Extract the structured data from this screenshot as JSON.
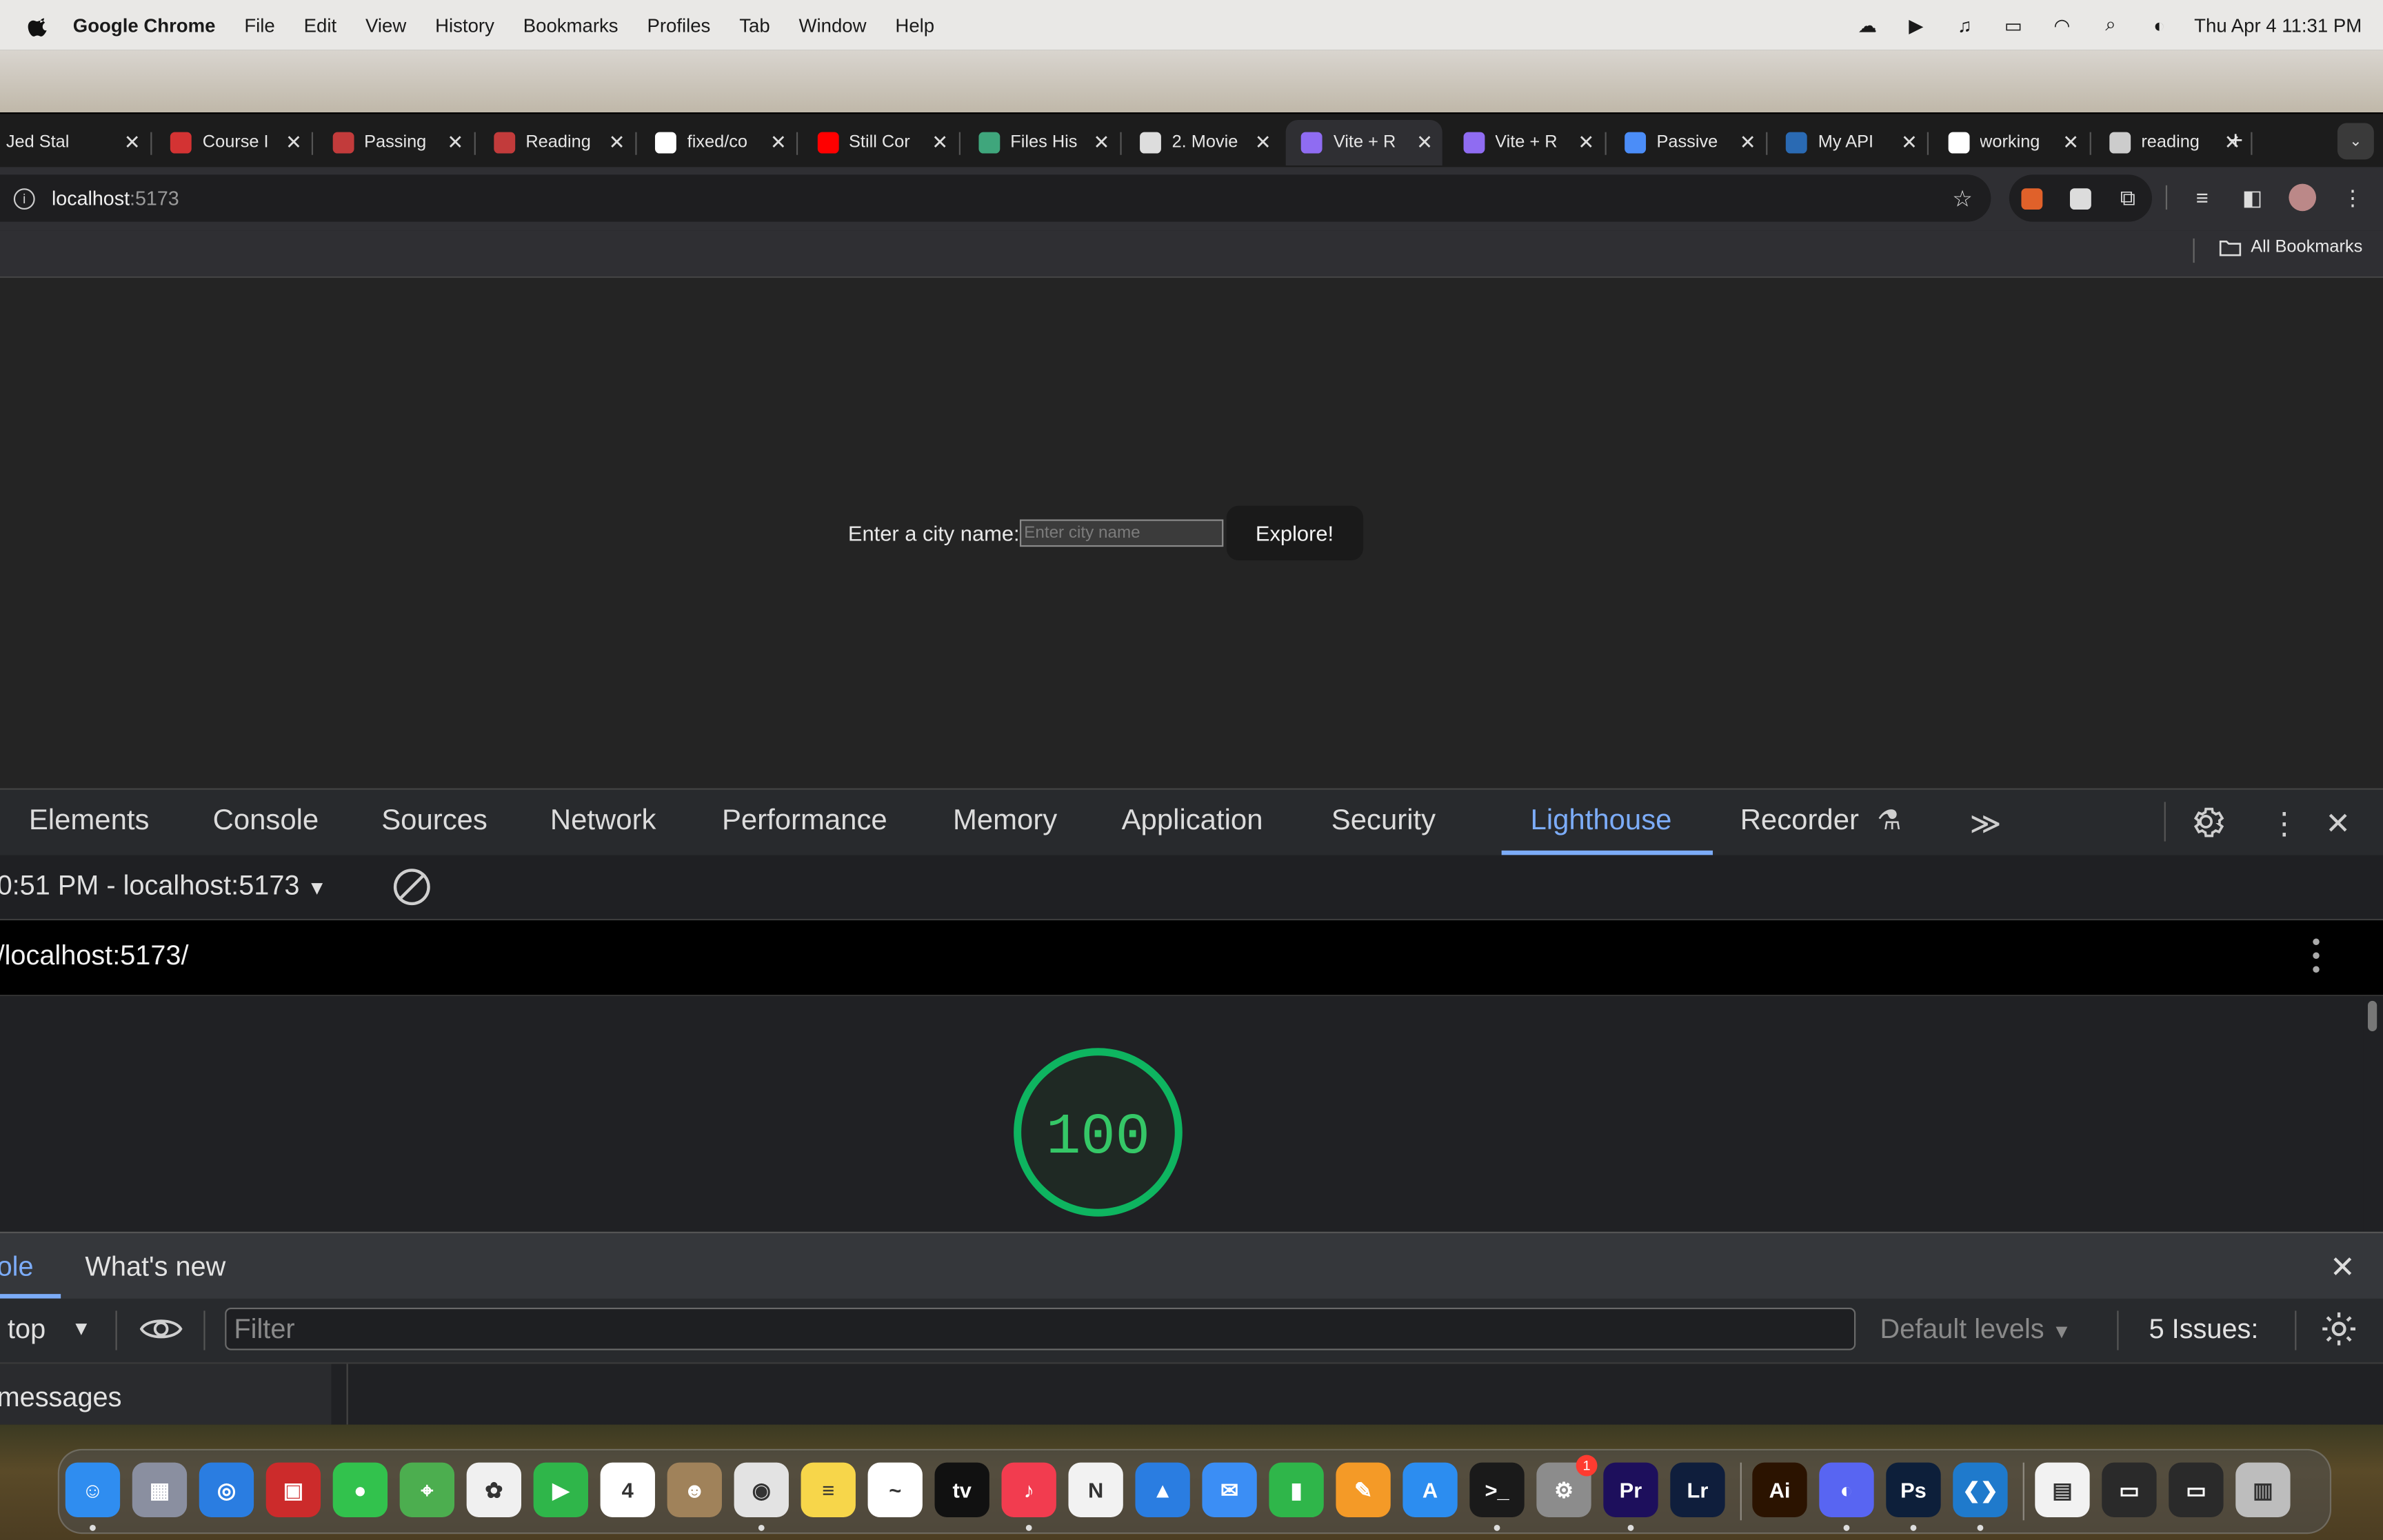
{
  "menubar": {
    "app_name": "Google Chrome",
    "items": [
      "File",
      "Edit",
      "View",
      "History",
      "Bookmarks",
      "Profiles",
      "Tab",
      "Window",
      "Help"
    ],
    "clock": "Thu Apr 4  11:31 PM"
  },
  "tabs": [
    {
      "title": "Jed Stal",
      "favicon": "#555555"
    },
    {
      "title": "Course I",
      "favicon": "#d33333"
    },
    {
      "title": "Passing",
      "favicon": "#c23b3b"
    },
    {
      "title": "Reading",
      "favicon": "#c23b3b"
    },
    {
      "title": "fixed/co",
      "favicon": "#ffffff"
    },
    {
      "title": "Still Cor",
      "favicon": "#ff0000"
    },
    {
      "title": "Files His",
      "favicon": "#3fa67c"
    },
    {
      "title": "2. Movie",
      "favicon": "#dddddd"
    },
    {
      "title": "Vite + R",
      "favicon": "#8f6cf2"
    },
    {
      "title": "Vite + R",
      "favicon": "#8f6cf2"
    },
    {
      "title": "Passive",
      "favicon": "#4b8df8"
    },
    {
      "title": "My API",
      "favicon": "#2a6ab3"
    },
    {
      "title": "working",
      "favicon": "#ffffff"
    },
    {
      "title": "reading",
      "favicon": "#cccccc"
    }
  ],
  "active_tab_index": 8,
  "address": {
    "host": "localhost",
    "port": ":5173"
  },
  "bookmarks": {
    "all_label": "All Bookmarks"
  },
  "page": {
    "label": "Enter a city name:",
    "placeholder": "Enter city name",
    "button": "Explore!"
  },
  "devtools": {
    "tabs": [
      "Elements",
      "Console",
      "Sources",
      "Network",
      "Performance",
      "Memory",
      "Application",
      "Security",
      "Lighthouse",
      "Recorder"
    ],
    "active_tab": "Lighthouse",
    "more_label": "≫",
    "report_selector": "0:51 PM - localhost:5173",
    "report_url": "/localhost:5173/",
    "score": "100",
    "score_value": 100
  },
  "drawer": {
    "tabs": [
      "ole",
      "What's new"
    ],
    "context": "top",
    "filter_placeholder": "Filter",
    "levels": "Default levels",
    "issues": "5 Issues:",
    "sidebar_item": "messages"
  },
  "dock": {
    "apps": [
      {
        "name": "Finder",
        "color": "#2f8df0",
        "glyph": "☺",
        "dot": true
      },
      {
        "name": "Launchpad",
        "color": "#8a8fa0",
        "glyph": "▦",
        "dot": false
      },
      {
        "name": "Safari",
        "color": "#2a7de1",
        "glyph": "◎",
        "dot": false
      },
      {
        "name": "Photo Booth",
        "color": "#cc2b2b",
        "glyph": "▣",
        "dot": false
      },
      {
        "name": "Messages",
        "color": "#32c24d",
        "glyph": "●",
        "dot": false
      },
      {
        "name": "Maps",
        "color": "#4cae4f",
        "glyph": "⌖",
        "dot": false
      },
      {
        "name": "Photos",
        "color": "#f0f0f0",
        "glyph": "✿",
        "dot": false
      },
      {
        "name": "FaceTime",
        "color": "#2fb64a",
        "glyph": "▶",
        "dot": false
      },
      {
        "name": "Calendar",
        "color": "#ffffff",
        "glyph": "4",
        "dot": false
      },
      {
        "name": "Contacts",
        "color": "#a0825a",
        "glyph": "☻",
        "dot": false
      },
      {
        "name": "Chrome",
        "color": "#e3e3e3",
        "glyph": "◉",
        "dot": true
      },
      {
        "name": "Notes",
        "color": "#f7d64a",
        "glyph": "≡",
        "dot": false
      },
      {
        "name": "Freeform",
        "color": "#ffffff",
        "glyph": "~",
        "dot": false
      },
      {
        "name": "TV",
        "color": "#111111",
        "glyph": "tv",
        "dot": false
      },
      {
        "name": "Music",
        "color": "#f23c4f",
        "glyph": "♪",
        "dot": true
      },
      {
        "name": "News",
        "color": "#f2f2f2",
        "glyph": "N",
        "dot": false
      },
      {
        "name": "Keynote",
        "color": "#2a7de1",
        "glyph": "▲",
        "dot": false
      },
      {
        "name": "Mail",
        "color": "#3b8ef5",
        "glyph": "✉",
        "dot": false
      },
      {
        "name": "Numbers",
        "color": "#2fb64a",
        "glyph": "▮",
        "dot": false
      },
      {
        "name": "Pages",
        "color": "#f49a27",
        "glyph": "✎",
        "dot": false
      },
      {
        "name": "App Store",
        "color": "#2c8df0",
        "glyph": "A",
        "dot": false
      },
      {
        "name": "Terminal",
        "color": "#1a1a1a",
        "glyph": ">_",
        "dot": true
      },
      {
        "name": "System Settings",
        "color": "#8c8c8c",
        "glyph": "⚙",
        "dot": false,
        "badge": "1"
      },
      {
        "name": "Premiere Pro",
        "color": "#1d0f5c",
        "glyph": "Pr",
        "dot": true
      },
      {
        "name": "Lightroom",
        "color": "#0f1e3c",
        "glyph": "Lr",
        "dot": false
      },
      {
        "name": "Illustrator",
        "color": "#2b1300",
        "glyph": "Ai",
        "dot": false
      },
      {
        "name": "Discord",
        "color": "#5865f2",
        "glyph": "◐",
        "dot": true
      },
      {
        "name": "Photoshop",
        "color": "#0d1f3a",
        "glyph": "Ps",
        "dot": true
      },
      {
        "name": "VS Code",
        "color": "#1f7acc",
        "glyph": "❮❯",
        "dot": true
      },
      {
        "name": "Document",
        "color": "#f2f2f2",
        "glyph": "▤",
        "dot": false
      },
      {
        "name": "Window 1",
        "color": "#2a2a2a",
        "glyph": "▭",
        "dot": false
      },
      {
        "name": "Window 2",
        "color": "#2a2a2a",
        "glyph": "▭",
        "dot": false
      },
      {
        "name": "Trash",
        "color": "#bdbdbd",
        "glyph": "▥",
        "dot": false
      }
    ]
  }
}
